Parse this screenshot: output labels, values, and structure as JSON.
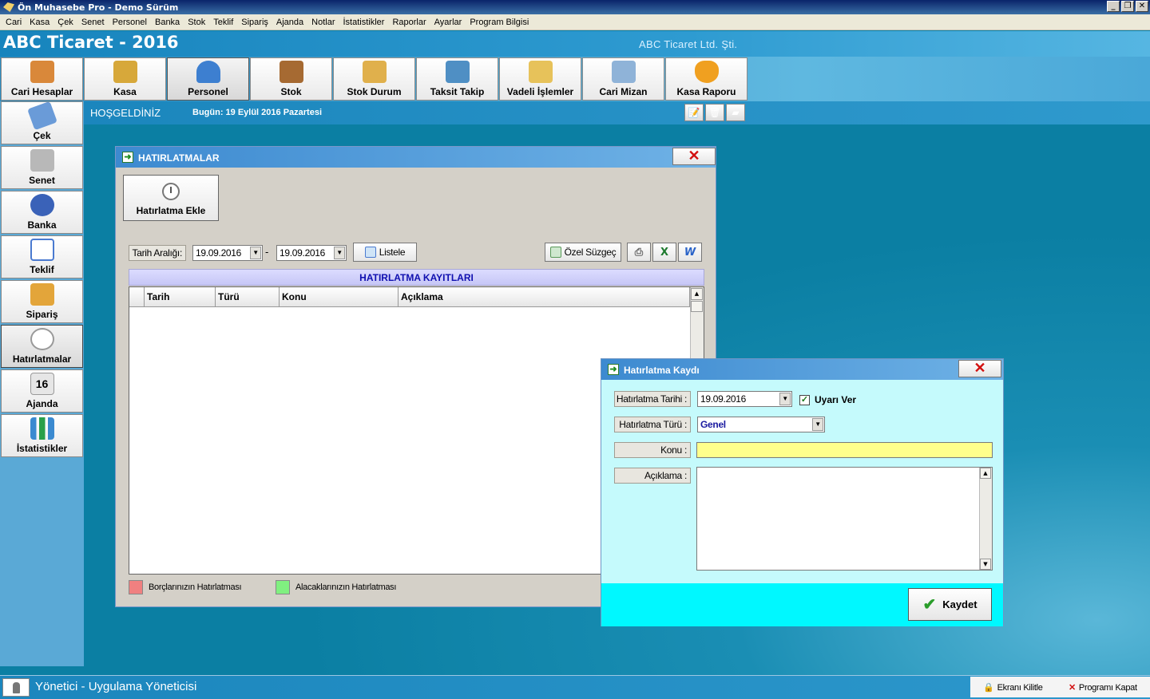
{
  "window": {
    "title": "Ön Muhasebe Pro - Demo Sürüm"
  },
  "menu": [
    "Cari",
    "Kasa",
    "Çek",
    "Senet",
    "Personel",
    "Banka",
    "Stok",
    "Teklif",
    "Sipariş",
    "Ajanda",
    "Notlar",
    "İstatistikler",
    "Raporlar",
    "Ayarlar",
    "Program Bilgisi"
  ],
  "header": {
    "company_title": "ABC Ticaret - 2016",
    "company_legal": "ABC Ticaret Ltd. Şti."
  },
  "toolbar": [
    {
      "label": "Cari Hesaplar",
      "icon": "users-icon",
      "color": "#d9883a"
    },
    {
      "label": "Kasa",
      "icon": "coins-icon",
      "color": "#d7a83a"
    },
    {
      "label": "Personel",
      "icon": "person-icon",
      "color": "#3d7fd0"
    },
    {
      "label": "Stok",
      "icon": "box-icon",
      "color": "#a66a32"
    },
    {
      "label": "Stok Durum",
      "icon": "stock-chart-icon",
      "color": "#e0b04c"
    },
    {
      "label": "Taksit Takip",
      "icon": "calendar-icon",
      "color": "#4f8fc4"
    },
    {
      "label": "Vadeli İşlemler",
      "icon": "folder-icon",
      "color": "#e7c25a"
    },
    {
      "label": "Cari Mizan",
      "icon": "balance-chart-icon",
      "color": "#8fb3d8"
    },
    {
      "label": "Kasa Raporu",
      "icon": "money-bag-icon",
      "color": "#f0a020"
    }
  ],
  "sidebar": [
    {
      "label": "Çek",
      "icon": "cheque-icon",
      "color": "#6a9bd8"
    },
    {
      "label": "Senet",
      "icon": "note-icon",
      "color": "#b8b8b8"
    },
    {
      "label": "Banka",
      "icon": "pie-chart-icon",
      "color": "#3a62b8"
    },
    {
      "label": "Teklif",
      "icon": "document-icon",
      "color": "#4a7ad0"
    },
    {
      "label": "Sipariş",
      "icon": "order-icon",
      "color": "#e3a53a"
    },
    {
      "label": "Hatırlatmalar",
      "icon": "alarm-clock-icon",
      "color": "#999999"
    },
    {
      "label": "Ajanda",
      "icon": "calendar-page-icon",
      "color": "#cfcfcf"
    },
    {
      "label": "İstatistikler",
      "icon": "bar-chart-icon",
      "color": "#3b8ad0"
    }
  ],
  "welcome": {
    "title": "HOŞGELDİNİZ",
    "date": "Bugün: 19 Eylül 2016 Pazartesi"
  },
  "reminders": {
    "title": "HATIRLATMALAR",
    "add_button": "Hatırlatma Ekle",
    "date_range_label": "Tarih Aralığı:",
    "date_from": "19.09.2016",
    "date_to": "19.09.2016",
    "range_separator": "-",
    "list_button": "Listele",
    "filter_button": "Özel Süzgeç",
    "grid_title": "HATIRLATMA KAYITLARI",
    "columns": [
      "Tarih",
      "Türü",
      "Konu",
      "Açıklama"
    ],
    "legend": [
      {
        "label": "Borçlarınızın Hatırlatması",
        "color": "#f08080"
      },
      {
        "label": "Alacaklarınızın Hatırlatması",
        "color": "#80f080"
      }
    ]
  },
  "record_dialog": {
    "title": "Hatırlatma Kaydı",
    "date_label": "Hatırlatma Tarihi :",
    "date_value": "19.09.2016",
    "warn_label": "Uyarı Ver",
    "type_label": "Hatırlatma Türü :",
    "type_value": "Genel",
    "subject_label": "Konu :",
    "description_label": "Açıklama :",
    "save_button": "Kaydet"
  },
  "status": {
    "user": "Yönetici - Uygulama Yöneticisi",
    "lock_screen": "Ekranı Kilitle",
    "close_program": "Programı Kapat"
  }
}
